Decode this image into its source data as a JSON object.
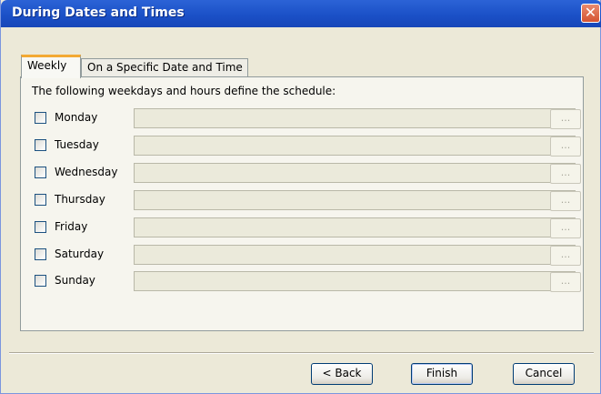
{
  "window": {
    "title": "During Dates and Times",
    "close_symbol": "✕"
  },
  "tabs": [
    {
      "label": "Weekly",
      "active": true
    },
    {
      "label": "On a Specific Date and Time",
      "active": false
    }
  ],
  "intro_text": "The following weekdays and hours define the schedule:",
  "days": [
    {
      "label": "Monday",
      "checked": false,
      "value": "",
      "button": "..."
    },
    {
      "label": "Tuesday",
      "checked": false,
      "value": "",
      "button": "..."
    },
    {
      "label": "Wednesday",
      "checked": false,
      "value": "",
      "button": "..."
    },
    {
      "label": "Thursday",
      "checked": false,
      "value": "",
      "button": "..."
    },
    {
      "label": "Friday",
      "checked": false,
      "value": "",
      "button": "..."
    },
    {
      "label": "Saturday",
      "checked": false,
      "value": "",
      "button": "..."
    },
    {
      "label": "Sunday",
      "checked": false,
      "value": "",
      "button": "..."
    }
  ],
  "buttons": {
    "back": "< Back",
    "finish": "Finish",
    "cancel": "Cancel"
  },
  "colors": {
    "titlebar": "#2C63D6",
    "dialog_bg": "#ECE9D8",
    "active_tab_accent": "#F3A933",
    "close_button": "#D65432"
  }
}
